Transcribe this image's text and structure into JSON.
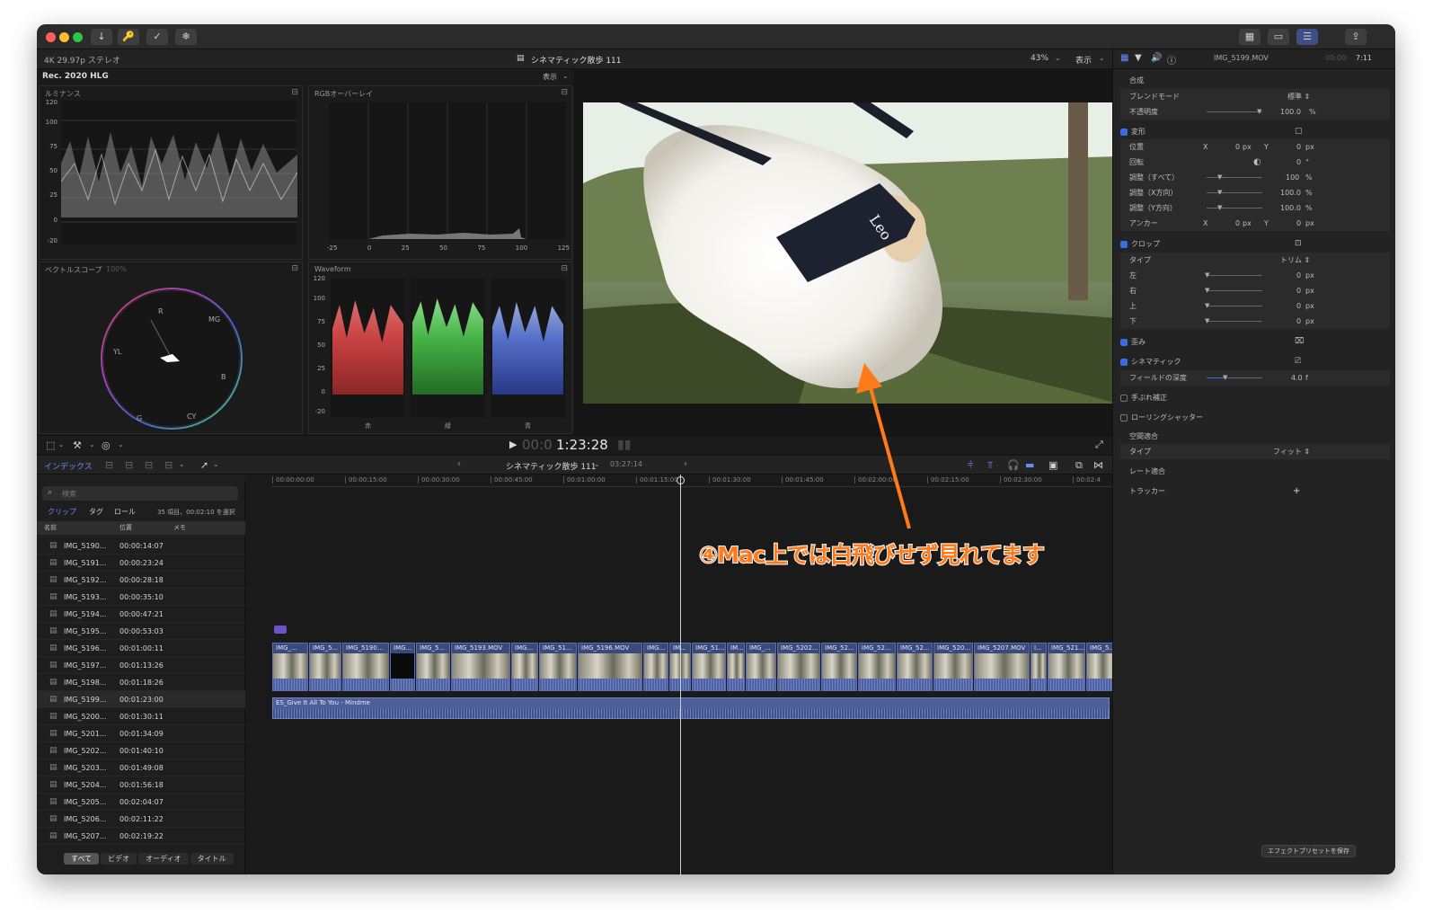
{
  "titlebar": {
    "buttons": [
      "↓",
      "🔑",
      "✓",
      "❄"
    ],
    "right_buttons": [
      "▦",
      "▭",
      "☰",
      "⇪"
    ]
  },
  "infobar": {
    "format": "4K 29.97p ステレオ",
    "project": "シネマティック散歩 111",
    "zoom": "43%",
    "view": "表示"
  },
  "scopes": {
    "colorspace": "Rec. 2020 HLG",
    "view_menu": "表示",
    "luminance": {
      "title": "ルミナンス",
      "ticks": [
        "120",
        "100",
        "75",
        "50",
        "25",
        "0",
        "-20"
      ]
    },
    "rgb_overlay": {
      "title": "RGBオーバーレイ",
      "xticks": [
        "-25",
        "0",
        "25",
        "50",
        "75",
        "100",
        "125"
      ]
    },
    "vectorscope": {
      "title": "ベクトルスコープ",
      "zoom": "100%",
      "labels": [
        "R",
        "MG",
        "B",
        "CY",
        "G",
        "YL"
      ]
    },
    "waveform": {
      "title": "Waveform",
      "ticks": [
        "120",
        "100",
        "75",
        "50",
        "25",
        "0",
        "-20"
      ],
      "channels": [
        "赤",
        "緑",
        "青"
      ]
    }
  },
  "viewer": {
    "timecode_dim": "00:0",
    "timecode": "1:23:28",
    "collar_text": "Leo"
  },
  "inspector": {
    "clip_name": "IMG_5199.MOV",
    "duration_dim": "00:00:",
    "duration": "7:11",
    "sections": {
      "compositing": "合成",
      "blend_mode_label": "ブレンドモード",
      "blend_mode_value": "標準 ⇕",
      "opacity_label": "不透明度",
      "opacity_value": "100.0",
      "transform": "変形",
      "position": "位置",
      "rotation": "回転",
      "scale_all": "調整（すべて）",
      "scale_x": "調整（X方向）",
      "scale_y": "調整（Y方向）",
      "anchor": "アンカー",
      "crop": "クロップ",
      "crop_type": "タイプ",
      "crop_type_value": "トリム ⇕",
      "left": "左",
      "right": "右",
      "top": "上",
      "bottom": "下",
      "distort": "歪み",
      "cinematic": "シネマティック",
      "depth_of_field": "フィールドの深度",
      "dof_value": "4.0",
      "dof_unit": "f",
      "stabilization": "手ぶれ補正",
      "rolling_shutter": "ローリングシャッター",
      "spatial_conform": "空間適合",
      "spatial_type": "タイプ",
      "spatial_type_value": "フィット ⇕",
      "rate_conform": "レート適合",
      "tracker": "トラッカー",
      "tracker_add": "+",
      "save_preset": "エフェクトプリセットを保存"
    },
    "values": {
      "x": "X",
      "y": "Y",
      "zero": "0",
      "px": "px",
      "deg": "°",
      "pct": "%",
      "s100": "100",
      "s1000": "100.0"
    }
  },
  "browser": {
    "index_tab": "インデックス",
    "search_placeholder": "検索",
    "filter_clips": "クリップ",
    "filter_tags": "タグ",
    "filter_roles": "ロール",
    "summary": "35 項目、00:02:10 を選択",
    "col_name": "名前",
    "col_position": "位置",
    "col_notes": "メモ",
    "rows": [
      {
        "name": "IMG_5190...",
        "pos": "00:00:14:07"
      },
      {
        "name": "IMG_5191...",
        "pos": "00:00:23:24"
      },
      {
        "name": "IMG_5192...",
        "pos": "00:00:28:18"
      },
      {
        "name": "IMG_5193...",
        "pos": "00:00:35:10"
      },
      {
        "name": "IMG_5194...",
        "pos": "00:00:47:21"
      },
      {
        "name": "IMG_5195...",
        "pos": "00:00:53:03"
      },
      {
        "name": "IMG_5196...",
        "pos": "00:01:00:11"
      },
      {
        "name": "IMG_5197...",
        "pos": "00:01:13:26"
      },
      {
        "name": "IMG_5198...",
        "pos": "00:01:18:26"
      },
      {
        "name": "IMG_5199...",
        "pos": "00:01:23:00"
      },
      {
        "name": "IMG_5200...",
        "pos": "00:01:30:11"
      },
      {
        "name": "IMG_5201...",
        "pos": "00:01:34:09"
      },
      {
        "name": "IMG_5202...",
        "pos": "00:01:40:10"
      },
      {
        "name": "IMG_5203...",
        "pos": "00:01:49:08"
      },
      {
        "name": "IMG_5204...",
        "pos": "00:01:56:18"
      },
      {
        "name": "IMG_5205...",
        "pos": "00:02:04:07"
      },
      {
        "name": "IMG_5206...",
        "pos": "00:02:11:22"
      },
      {
        "name": "IMG_5207...",
        "pos": "00:02:19:22"
      }
    ],
    "bottom_tabs": [
      "すべて",
      "ビデオ",
      "オーディオ",
      "タイトル"
    ]
  },
  "timeline": {
    "project": "シネマティック散歩 111",
    "duration": "03:27:14",
    "ruler": [
      "00:00:00:00",
      "00:00:15:00",
      "00:00:30:00",
      "00:00:45:00",
      "00:01:00:00",
      "00:01:15:00",
      "00:01:30:00",
      "00:01:45:00",
      "00:02:00:00",
      "00:02:15:00",
      "00:02:30:00",
      "00:02:4"
    ],
    "clips": [
      "IMG_...",
      "IMG_5...",
      "IMG_5190...",
      "IMG...",
      "IMG_5...",
      "IMG_5193.MOV",
      "IMG...",
      "IMG_51...",
      "IMG_5196.MOV",
      "IMG...",
      "IM...",
      "IMG_51...",
      "IM...",
      "IMG_...",
      "IMG_5202...",
      "IMG_52...",
      "IMG_52...",
      "IMG_52...",
      "IMG_520...",
      "IMG_5207.MOV",
      "I...",
      "IMG_521...",
      "IMG_5..."
    ],
    "audio": "ES_Give It All To You - Mindme"
  },
  "annotation": "④Mac上では白飛びせず見れてます",
  "colors": {
    "accent": "#3d6be0",
    "annotation": "#ff7a1a",
    "clip": "#3a4a7a"
  }
}
